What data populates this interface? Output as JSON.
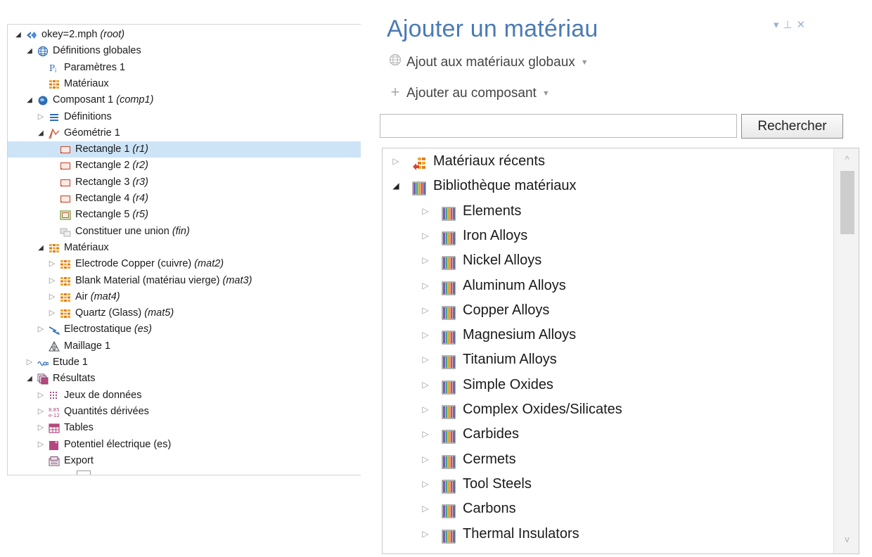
{
  "model_tree": {
    "nodes": [
      {
        "label": "okey=2.mph",
        "tag": "(root)",
        "icon": "comsol-root-icon",
        "toggle": "expanded"
      },
      {
        "label": "Définitions globales",
        "tag": "",
        "icon": "globe-icon",
        "toggle": "expanded"
      },
      {
        "label": "Paramètres 1",
        "tag": "",
        "icon": "parameters-icon",
        "toggle": "none"
      },
      {
        "label": "Matériaux",
        "tag": "",
        "icon": "materials-icon",
        "toggle": "none"
      },
      {
        "label": "Composant 1",
        "tag": "(comp1)",
        "icon": "component-icon",
        "toggle": "expanded"
      },
      {
        "label": "Définitions",
        "tag": "",
        "icon": "definitions-icon",
        "toggle": "collapsed"
      },
      {
        "label": "Géométrie 1",
        "tag": "",
        "icon": "geometry-icon",
        "toggle": "expanded"
      },
      {
        "label": "Rectangle 1",
        "tag": "(r1)",
        "icon": "rectangle-icon",
        "toggle": "none",
        "selected": true
      },
      {
        "label": "Rectangle 2",
        "tag": "(r2)",
        "icon": "rectangle-icon",
        "toggle": "none"
      },
      {
        "label": "Rectangle 3",
        "tag": "(r3)",
        "icon": "rectangle-icon",
        "toggle": "none"
      },
      {
        "label": "Rectangle 4",
        "tag": "(r4)",
        "icon": "rectangle-icon",
        "toggle": "none"
      },
      {
        "label": "Rectangle 5",
        "tag": "(r5)",
        "icon": "rectangle-green-icon",
        "toggle": "none"
      },
      {
        "label": "Constituer une union",
        "tag": "(fin)",
        "icon": "form-union-icon",
        "toggle": "none"
      },
      {
        "label": "Matériaux",
        "tag": "",
        "icon": "materials-icon",
        "toggle": "expanded"
      },
      {
        "label": "Electrode Copper (cuivre)",
        "tag": "(mat2)",
        "icon": "materials-icon",
        "toggle": "collapsed"
      },
      {
        "label": "Blank Material (matériau vierge)",
        "tag": "(mat3)",
        "icon": "materials-icon",
        "toggle": "collapsed"
      },
      {
        "label": "Air",
        "tag": "(mat4)",
        "icon": "materials-icon",
        "toggle": "collapsed"
      },
      {
        "label": "Quartz (Glass)",
        "tag": "(mat5)",
        "icon": "materials-icon",
        "toggle": "collapsed"
      },
      {
        "label": "Electrostatique",
        "tag": "(es)",
        "icon": "electrostatics-icon",
        "toggle": "collapsed"
      },
      {
        "label": "Maillage 1",
        "tag": "",
        "icon": "mesh-icon",
        "toggle": "none"
      },
      {
        "label": "Etude 1",
        "tag": "",
        "icon": "study-icon",
        "toggle": "collapsed"
      },
      {
        "label": "Résultats",
        "tag": "",
        "icon": "results-icon",
        "toggle": "expanded"
      },
      {
        "label": "Jeux de données",
        "tag": "",
        "icon": "datasets-icon",
        "toggle": "collapsed"
      },
      {
        "label": "Quantités dérivées",
        "tag": "",
        "icon": "derived-values-icon",
        "toggle": "collapsed"
      },
      {
        "label": "Tables",
        "tag": "",
        "icon": "table-icon",
        "toggle": "collapsed"
      },
      {
        "label": "Potentiel électrique (es)",
        "tag": "",
        "icon": "plot-group-icon",
        "toggle": "collapsed"
      },
      {
        "label": "Export",
        "tag": "",
        "icon": "export-icon",
        "toggle": "none"
      }
    ]
  },
  "add_material": {
    "title": "Ajouter un matériau",
    "add_global_label": "Ajout aux matériaux globaux",
    "add_component_label": "Ajouter au composant",
    "search_value": "",
    "search_button": "Rechercher",
    "library_nodes": [
      {
        "label": "Matériaux récents",
        "icon": "recent-materials-icon",
        "toggle": "collapsed"
      },
      {
        "label": "Bibliothèque matériaux",
        "icon": "material-library-icon",
        "toggle": "expanded"
      },
      {
        "label": "Elements",
        "icon": "material-library-icon",
        "toggle": "collapsed"
      },
      {
        "label": "Iron Alloys",
        "icon": "material-library-icon",
        "toggle": "collapsed"
      },
      {
        "label": "Nickel Alloys",
        "icon": "material-library-icon",
        "toggle": "collapsed"
      },
      {
        "label": "Aluminum Alloys",
        "icon": "material-library-icon",
        "toggle": "collapsed"
      },
      {
        "label": "Copper Alloys",
        "icon": "material-library-icon",
        "toggle": "collapsed"
      },
      {
        "label": "Magnesium Alloys",
        "icon": "material-library-icon",
        "toggle": "collapsed"
      },
      {
        "label": "Titanium Alloys",
        "icon": "material-library-icon",
        "toggle": "collapsed"
      },
      {
        "label": "Simple Oxides",
        "icon": "material-library-icon",
        "toggle": "collapsed"
      },
      {
        "label": "Complex Oxides/Silicates",
        "icon": "material-library-icon",
        "toggle": "collapsed"
      },
      {
        "label": "Carbides",
        "icon": "material-library-icon",
        "toggle": "collapsed"
      },
      {
        "label": "Cermets",
        "icon": "material-library-icon",
        "toggle": "collapsed"
      },
      {
        "label": "Tool Steels",
        "icon": "material-library-icon",
        "toggle": "collapsed"
      },
      {
        "label": "Carbons",
        "icon": "material-library-icon",
        "toggle": "collapsed"
      },
      {
        "label": "Thermal Insulators",
        "icon": "material-library-icon",
        "toggle": "collapsed"
      }
    ]
  },
  "colors": {
    "selection": "#cde4f7",
    "title": "#4a7bb4",
    "materials_icon": "#f0a830"
  }
}
